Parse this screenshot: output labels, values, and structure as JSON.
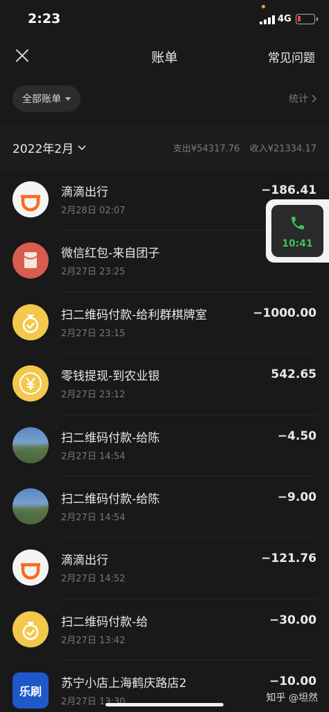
{
  "status_bar": {
    "time": "2:23",
    "network": "4G"
  },
  "nav": {
    "title": "账单",
    "help": "常见问题"
  },
  "filter": {
    "label": "全部账单",
    "stats": "统计"
  },
  "month_bar": {
    "month": "2022年2月",
    "expense": "支出¥54317.76",
    "income": "收入¥21334.17"
  },
  "transactions": [
    {
      "title": "滴滴出行",
      "time": "2月28日 02:07",
      "amount": "−186.41",
      "icon": "didi-icon"
    },
    {
      "title": "微信红包-来自团子",
      "time": "2月27日 23:25",
      "amount": "",
      "icon": "red-packet-icon"
    },
    {
      "title": "扫二维码付款-给利群棋牌室",
      "time": "2月27日 23:15",
      "amount": "−1000.00",
      "icon": "money-bag-icon"
    },
    {
      "title": "零钱提现-到农业银",
      "time": "2月27日 23:12",
      "amount": "542.65",
      "icon": "yen-coin-icon"
    },
    {
      "title": "扫二维码付款-给陈",
      "time": "2月27日 14:54",
      "amount": "−4.50",
      "icon": "landscape-avatar"
    },
    {
      "title": "扫二维码付款-给陈",
      "time": "2月27日 14:54",
      "amount": "−9.00",
      "icon": "landscape-avatar"
    },
    {
      "title": "滴滴出行",
      "time": "2月27日 14:52",
      "amount": "−121.76",
      "icon": "didi-icon"
    },
    {
      "title": "扫二维码付款-给",
      "time": "2月27日 13:42",
      "amount": "−30.00",
      "icon": "money-bag-icon"
    },
    {
      "title": "苏宁小店上海鹤庆路店2",
      "time": "2月27日 13:30",
      "amount": "−10.00",
      "icon": "lesu-logo",
      "logo_text": "乐刷"
    }
  ],
  "call_float": {
    "time": "10:41"
  },
  "watermark": "知乎 @坦然",
  "colors": {
    "accent_green": "#3ec15a",
    "background": "#191919"
  }
}
